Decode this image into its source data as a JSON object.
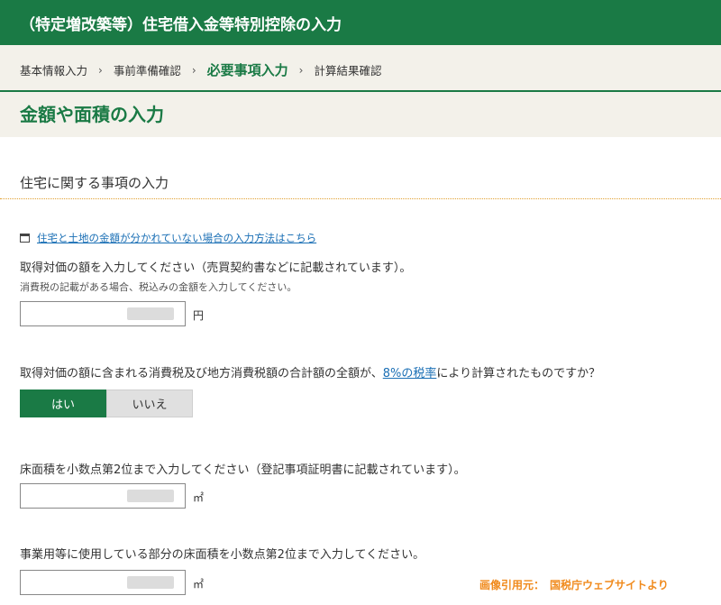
{
  "header": {
    "title": "（特定増改築等）住宅借入金等特別控除の入力"
  },
  "breadcrumb": {
    "steps": [
      {
        "label": "基本情報入力"
      },
      {
        "label": "事前準備確認"
      },
      {
        "label": "必要事項入力"
      },
      {
        "label": "計算結果確認"
      }
    ],
    "separator": "›"
  },
  "page": {
    "title": "金額や面積の入力"
  },
  "section": {
    "heading": "住宅に関する事項の入力"
  },
  "help_link": {
    "label": "住宅と土地の金額が分かれていない場合の入力方法はこちら",
    "icon": "document-icon"
  },
  "acquisition_price": {
    "label": "取得対価の額を入力してください（売買契約書などに記載されています）。",
    "note": "消費税の記載がある場合、税込みの金額を入力してください。",
    "unit": "円"
  },
  "tax_rate_question": {
    "text_before": "取得対価の額に含まれる消費税及び地方消費税額の合計額の全額が、",
    "link": "8%の税率",
    "text_after": "により計算されたものですか？",
    "options": {
      "yes": "はい",
      "no": "いいえ"
    },
    "selected": "はい"
  },
  "floor_area": {
    "label": "床面積を小数点第2位まで入力してください（登記事項証明書に記載されています）。",
    "unit": "㎡"
  },
  "business_floor_area": {
    "label": "事業用等に使用している部分の床面積を小数点第2位まで入力してください。",
    "unit": "㎡"
  },
  "credit": {
    "text": "画像引用元：　国税庁ウェブサイトより"
  },
  "colors": {
    "brand_green": "#1a7a45",
    "link_blue": "#1a6fb5",
    "hero_bg": "#f3f1ea",
    "credit_orange": "#f08a1c",
    "dotted_rule": "#e0a030"
  }
}
